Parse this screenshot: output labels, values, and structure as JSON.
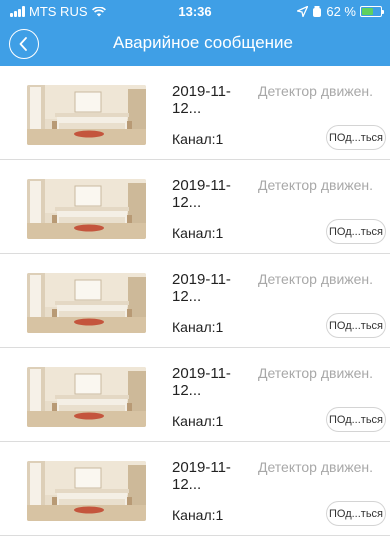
{
  "status_bar": {
    "carrier": "MTS RUS",
    "time": "13:36",
    "battery": "62 %",
    "battery_level": 0.62
  },
  "nav": {
    "title": "Аварийное сообщение",
    "back_icon": "chevron-left-icon"
  },
  "alarms": [
    {
      "date": "2019-11-",
      "date_rest": "12...",
      "event": "Детектор движен.",
      "channel": "Канал:1",
      "action": "ПОд...ться"
    },
    {
      "date": "2019-11-",
      "date_rest": "12...",
      "event": "Детектор движен.",
      "channel": "Канал:1",
      "action": "ПОд...ться"
    },
    {
      "date": "2019-11-",
      "date_rest": "12...",
      "event": "Детектор движен.",
      "channel": "Канал:1",
      "action": "ПОд...ться"
    },
    {
      "date": "2019-11-",
      "date_rest": "12...",
      "event": "Детектор движен.",
      "channel": "Канал:1",
      "action": "ПОд...ться"
    },
    {
      "date": "2019-11-",
      "date_rest": "12...",
      "event": "Детектор движен.",
      "channel": "Канал:1",
      "action": "ПОд...ться"
    }
  ],
  "colors": {
    "header": "#3f9fe6",
    "event_text": "#a8a8a8",
    "divider": "#dcdcdc"
  }
}
